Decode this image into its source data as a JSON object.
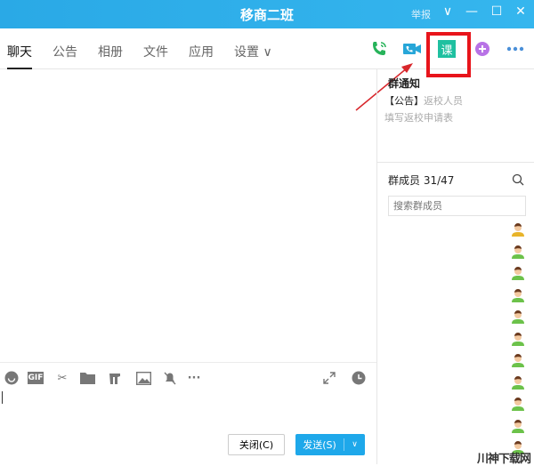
{
  "window": {
    "title": "移商二班",
    "report": "举报",
    "minimize": "—",
    "maximize": "☐",
    "close": "✕",
    "menu": "∨"
  },
  "tabs": [
    {
      "label": "聊天"
    },
    {
      "label": "公告"
    },
    {
      "label": "相册"
    },
    {
      "label": "文件"
    },
    {
      "label": "应用"
    },
    {
      "label": "设置 ∨"
    }
  ],
  "toolbar_icons": {
    "lesson_label": "课"
  },
  "notice": {
    "title": "群通知",
    "tag": "【公告】",
    "text": "返校人员",
    "sub": "填写返校申请表"
  },
  "members": {
    "title": "群成员 31/47",
    "search_placeholder": "搜索群成员",
    "avatar_colors": [
      "#e8b42a",
      "#6cc24a",
      "#6cc24a",
      "#6cc24a",
      "#6cc24a",
      "#6cc24a",
      "#6cc24a",
      "#6cc24a",
      "#6cc24a",
      "#6cc24a",
      "#6cc24a"
    ]
  },
  "input": {
    "gif": "GIF",
    "more": "···",
    "close_button": "关闭(C)",
    "send_button": "发送(S)"
  },
  "colors": {
    "accent": "#1ea8ea",
    "highlight": "#e8141b"
  },
  "watermark": "川神下载网"
}
